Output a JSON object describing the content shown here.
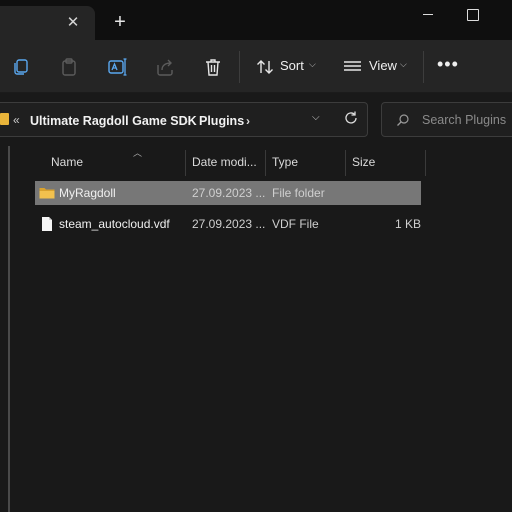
{
  "window": {
    "tab_close_glyph": "✕",
    "new_tab_glyph": "+"
  },
  "toolbar": {
    "sort_label": "Sort",
    "view_label": "View",
    "more_glyph": "•••",
    "icons": [
      "copy-icon",
      "paste-icon",
      "rename-icon",
      "share-icon",
      "delete-icon",
      "sort-icon",
      "view-icon",
      "more-icon"
    ]
  },
  "address": {
    "overflow_glyph": "«",
    "crumbs": [
      "Ultimate Ragdoll Game SDK",
      "Plugins"
    ],
    "separator": "›",
    "dropdown_glyph": "⌵"
  },
  "search": {
    "placeholder": "Search Plugins"
  },
  "columns": {
    "name": "Name",
    "date": "Date modi...",
    "type": "Type",
    "size": "Size"
  },
  "files": [
    {
      "name": "MyRagdoll",
      "date": "27.09.2023 ...",
      "type": "File folder",
      "size": "",
      "icon": "folder-icon",
      "selected": true
    },
    {
      "name": "steam_autocloud.vdf",
      "date": "27.09.2023 ...",
      "type": "VDF File",
      "size": "1 KB",
      "icon": "file-icon",
      "selected": false
    }
  ],
  "colors": {
    "background": "#191919",
    "toolbar": "#252525",
    "selection": "#777777",
    "folder": "#e8b43a"
  }
}
